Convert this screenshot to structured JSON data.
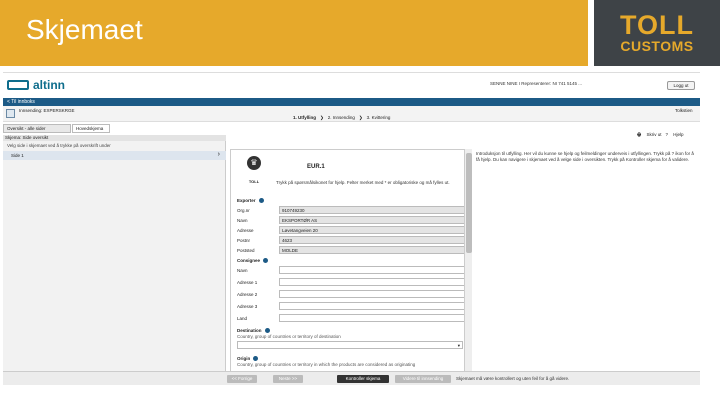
{
  "slide": {
    "title": "Skjemaet",
    "logo_top": "TOLL",
    "logo_bottom": "CUSTOMS"
  },
  "colors": {
    "accent": "#e6a92b",
    "logo_bg": "#3e4347",
    "altinn_blue": "#1c5a86"
  },
  "altinn": {
    "brand": "altinn",
    "user_info": "SENNE NINE I Representerer: NI 741 5145 ...",
    "logout": "Logg ut",
    "back": "< Til innboks"
  },
  "form": {
    "name": "Innsending: EXPERSKRGE",
    "steps": [
      "1. Utfylling",
      "2. Innsending",
      "3. Kvittering"
    ],
    "language": "Tolkstien"
  },
  "tabs": [
    "Oversikt - alle sider",
    "Hovedskjema"
  ],
  "help": [
    "Skriv ut",
    "Hjelp"
  ],
  "sidebar": {
    "header": "Skjema: Side oversikt",
    "description": "Velg side i skjemaet ved å trykke på overskrift under",
    "item": "Side 1"
  },
  "doc": {
    "code": "EUR.1",
    "intro": "Trykk på spørsmålsikonet for hjelp. Felter merket med * er obligatoriske og må fylles ut.",
    "exporter_label": "Exporter",
    "exporter": [
      {
        "label": "Org.nr",
        "value": "910749230"
      },
      {
        "label": "Navn",
        "value": "EKSPORTØR AS"
      },
      {
        "label": "Adresse",
        "value": "Løvetangveien 20"
      },
      {
        "label": "Postnr",
        "value": "4623"
      },
      {
        "label": "Poststed",
        "value": "MOLDE"
      }
    ],
    "consignee_label": "Consignee",
    "consignee": [
      {
        "label": "Navn",
        "value": ""
      },
      {
        "label": "Adresse 1",
        "value": ""
      },
      {
        "label": "Adresse 2",
        "value": ""
      },
      {
        "label": "Adresse 3",
        "value": ""
      },
      {
        "label": "Land",
        "value": ""
      }
    ],
    "destination_label": "Destination",
    "destination_help": "Country, group of countries or territory of destination",
    "origin_label": "Origin",
    "origin_help": "Country, group of countries or territory in which the products are considered as originating"
  },
  "right_help": "Introduksjon til utfylling. Her vil du kunne se hjelp og feilmeldinger underveis i utfyllingen. Trykk på ? ikon for å få hjelp. Du kan navigere i skjemaet ved å velge side i oversikten. Trykk på Kontroller skjema for å validere.",
  "bottom": {
    "buttons": [
      "<< Forrige",
      "Neste >>",
      "Kontroller skjema",
      "Videre til innsending"
    ],
    "message": "Skjemaet må være kontrollert og uten feil for å gå videre."
  }
}
